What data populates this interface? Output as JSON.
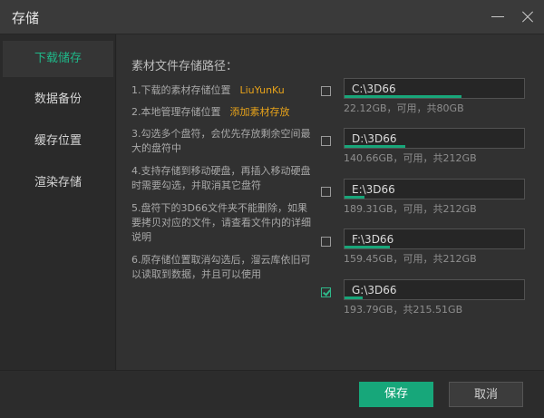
{
  "window": {
    "title": "存储"
  },
  "sidebar": {
    "items": [
      {
        "label": "下载储存",
        "active": true
      },
      {
        "label": "数据备份",
        "active": false
      },
      {
        "label": "缓存位置",
        "active": false
      },
      {
        "label": "渲染存储",
        "active": false
      }
    ]
  },
  "main": {
    "section_label": "素材文件存储路径：",
    "notes": {
      "n1_text": "1.下载的素材存储位置",
      "n1_value": "LiuYunKu",
      "n2_text": "2.本地管理存储位置",
      "n2_link": "添加素材存放",
      "n3": "3.勾选多个盘符，会优先存放剩余空间最大的盘符中",
      "n4": "4.支持存储到移动硬盘，再插入移动硬盘时需要勾选，并取消其它盘符",
      "n5": "5.盘符下的3D66文件夹不能删除，如果要拷贝对应的文件，请查看文件内的详细说明",
      "n6": "6.原存储位置取消勾选后，溜云库依旧可以读取到数据，并且可以使用"
    },
    "drives": [
      {
        "path": "C:\\3D66",
        "capacity": "22.12GB，可用，共80GB",
        "checked": false,
        "used_fraction": 0.65
      },
      {
        "path": "D:\\3D66",
        "capacity": "140.66GB，可用，共212GB",
        "checked": false,
        "used_fraction": 0.34
      },
      {
        "path": "E:\\3D66",
        "capacity": "189.31GB，可用，共212GB",
        "checked": false,
        "used_fraction": 0.11
      },
      {
        "path": "F:\\3D66",
        "capacity": "159.45GB，可用，共212GB",
        "checked": false,
        "used_fraction": 0.25
      },
      {
        "path": "G:\\3D66",
        "capacity": "193.79GB，共215.51GB",
        "checked": true,
        "used_fraction": 0.1
      }
    ]
  },
  "footer": {
    "save_label": "保存",
    "cancel_label": "取消"
  },
  "colors": {
    "accent": "#1fb889",
    "warning": "#e8a31a",
    "background": "#2f2f2f"
  }
}
